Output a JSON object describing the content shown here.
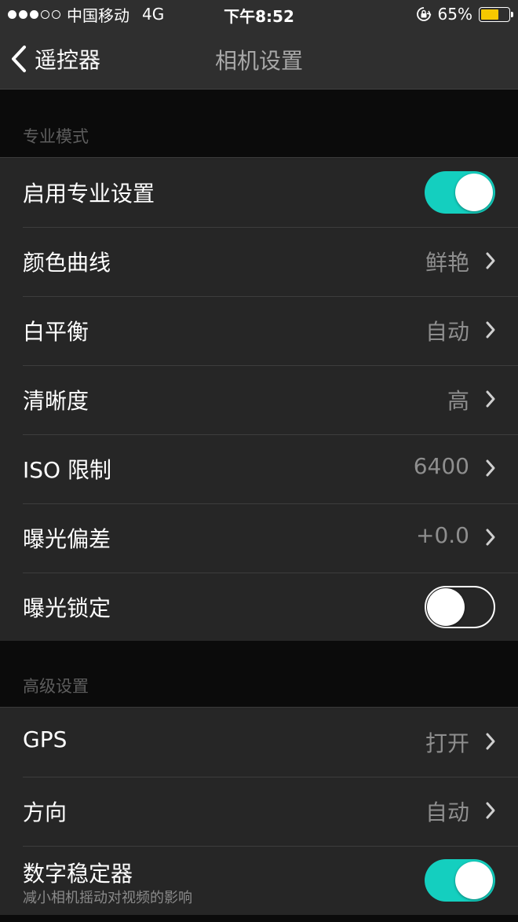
{
  "status_bar": {
    "carrier": "中国移动",
    "network": "4G",
    "time": "下午8:52",
    "battery_percent": "65%",
    "battery_level": 0.65,
    "battery_color": "#f6c800"
  },
  "nav": {
    "back_label": "遥控器",
    "title": "相机设置"
  },
  "sections": {
    "pro": {
      "header": "专业模式"
    },
    "advanced": {
      "header": "高级设置"
    }
  },
  "rows": {
    "enable_pro": {
      "label": "启用专业设置",
      "on": true
    },
    "color_curve": {
      "label": "颜色曲线",
      "value": "鲜艳"
    },
    "white_balance": {
      "label": "白平衡",
      "value": "自动"
    },
    "sharpness": {
      "label": "清晰度",
      "value": "高"
    },
    "iso_limit": {
      "label": "ISO 限制",
      "value": "6400"
    },
    "exposure_bias": {
      "label": "曝光偏差",
      "value": "+0.0"
    },
    "exposure_lock": {
      "label": "曝光锁定",
      "on": false
    },
    "gps": {
      "label": "GPS",
      "value": "打开"
    },
    "orientation": {
      "label": "方向",
      "value": "自动"
    },
    "stabilizer": {
      "label": "数字稳定器",
      "sublabel": "减小相机摇动对视频的影响",
      "on": true
    }
  },
  "colors": {
    "toggle_on": "#14cfbf",
    "background": "#0b0b0b",
    "cell": "#262626"
  }
}
